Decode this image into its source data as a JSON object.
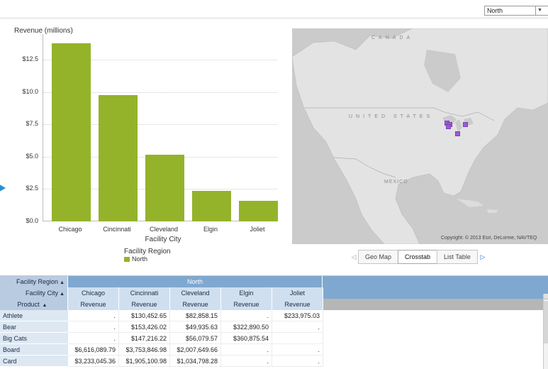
{
  "filter": {
    "region_value": "North"
  },
  "chart_data": {
    "type": "bar",
    "title": "Revenue (millions)",
    "categories": [
      "Chicago",
      "Cincinnati",
      "Cleveland",
      "Elgin",
      "Joliet"
    ],
    "values": [
      13.8,
      9.75,
      5.15,
      2.35,
      1.6
    ],
    "xlabel": "Facility City",
    "ylabel": "",
    "ylim": [
      0,
      14.5
    ],
    "yticks": [
      "$0.0",
      "$2.5",
      "$5.0",
      "$7.5",
      "$10.0",
      "$12.5"
    ],
    "ytick_values": [
      0,
      2.5,
      5,
      7.5,
      10,
      12.5
    ],
    "grid": true,
    "legend": {
      "title": "Facility Region",
      "items": [
        "North"
      ],
      "placement": "bottom"
    },
    "bar_color": "#94b32b"
  },
  "map": {
    "labels": {
      "canada": "CANADA",
      "united_states": "UNITED STATES",
      "mexico": "MEXICO"
    },
    "copyright": "Copyright: © 2013 Esri, DeLorme, NAVTEQ"
  },
  "views": {
    "geo_map": "Geo Map",
    "crosstab": "Crosstab",
    "list_table": "List Table",
    "active": "Crosstab"
  },
  "crosstab": {
    "row_headers": {
      "facility_region": "Facility Region",
      "facility_city": "Facility City",
      "product": "Product"
    },
    "region_value": "North",
    "cities": [
      "Chicago",
      "Cincinnati",
      "Cleveland",
      "Elgin",
      "Joliet"
    ],
    "measure": "Revenue",
    "rows": [
      {
        "product": "Athlete",
        "values": [
          ".",
          "$130,452.65",
          "$82,858.15",
          ".",
          "$233,975.03"
        ]
      },
      {
        "product": "Bear",
        "values": [
          ".",
          "$153,426.02",
          "$49,935.63",
          "$322,890.50",
          "."
        ]
      },
      {
        "product": "Big Cats",
        "values": [
          ".",
          "$147,216.22",
          "$56,079.57",
          "$360,875.54",
          ""
        ]
      },
      {
        "product": "Board",
        "values": [
          "$6,616,089.79",
          "$3,753,846.98",
          "$2,007,649.66",
          ".",
          "."
        ]
      },
      {
        "product": "Card",
        "values": [
          "$3,233,045.36",
          "$1,905,100.98",
          "$1,034,798.28",
          ".",
          "."
        ]
      }
    ]
  },
  "colors": {
    "bar": "#94b32b",
    "map_dot": "#9a5bd3",
    "header_blue": "#7fa8d0",
    "accent_arrow": "#2a8fd0"
  }
}
